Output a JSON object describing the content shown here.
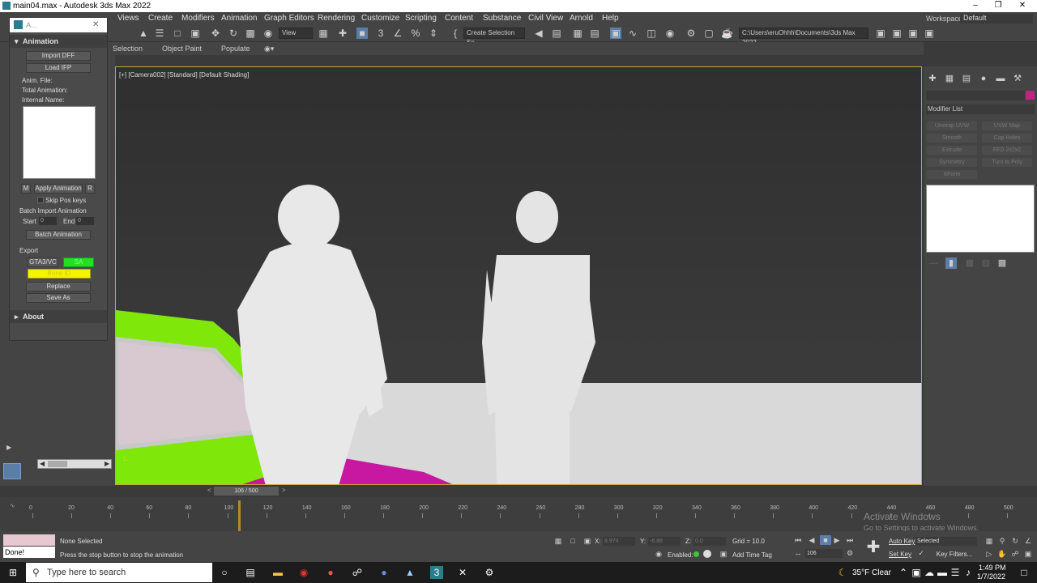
{
  "window": {
    "title": "main04.max - Autodesk 3ds Max 2022"
  },
  "menu": [
    "Views",
    "Create",
    "Modifiers",
    "Animation",
    "Graph Editors",
    "Rendering",
    "Customize",
    "Scripting",
    "Content",
    "Substance",
    "Civil View",
    "Arnold",
    "Help"
  ],
  "workspace": {
    "label": "Workspaces:",
    "value": "Default"
  },
  "toolbar": {
    "view_dropdown": "View",
    "selection_set_placeholder": "Create Selection Se",
    "project_path": "C:\\Users\\eruOhhh\\Documents\\3ds Max 2022"
  },
  "ribbon": [
    "Selection",
    "Object Paint",
    "Populate"
  ],
  "float_panel": {
    "title": "A...",
    "animation_rollout": "Animation",
    "import_dff": "Import DFF",
    "load_ifp": "Load IFP",
    "anim_file": "Anim. File:",
    "total_animation": "Total Animation:",
    "internal_name": "Internal Name:",
    "m_btn": "M",
    "apply_animation": "Apply Animation",
    "r_btn": "R",
    "skip_pos_keys": "Skip Pos keys",
    "batch_import": "Batch Import Animation",
    "start_label": "Start",
    "start_value": "0",
    "end_label": "End",
    "end_value": "0",
    "batch_animation": "Batch Animation",
    "export_label": "Export",
    "gta_btn": "GTA3/VC",
    "sa_btn": "SA",
    "bone_id": "Bone ID",
    "replace": "Replace",
    "save_as": "Save As",
    "about_rollout": "About"
  },
  "viewport": {
    "label": "[+] [Camera002] [Standard] [Default Shading]"
  },
  "command_panel": {
    "modifier_list": "Modifier List",
    "modifier_buttons": [
      "Unwrap UVW",
      "UVW Map",
      "Smooth",
      "Cap Holes",
      "Extrude",
      "FFD 2x2x2",
      "Symmetry",
      "Turn to Poly",
      "XForm"
    ],
    "object_color": "#c8207f"
  },
  "time_slider": {
    "label": "106 / 500",
    "current_frame": 106,
    "total_frames": 500
  },
  "trackbar": {
    "ticks": [
      "0",
      "20",
      "40",
      "60",
      "80",
      "100",
      "120",
      "140",
      "160",
      "180",
      "200",
      "220",
      "240",
      "260",
      "280",
      "300",
      "320",
      "340",
      "360",
      "380",
      "400",
      "420",
      "440",
      "460",
      "480",
      "500"
    ]
  },
  "activation": {
    "title": "Activate Windows",
    "subtitle": "Go to Settings to activate Windows."
  },
  "status": {
    "selection": "None Selected",
    "prompt": "Press the stop button to stop the animation",
    "done": "Done!",
    "x_label": "X:",
    "x_value": "8.974",
    "y_label": "Y:",
    "y_value": "-6.86",
    "z_label": "Z:",
    "z_value": "0.0",
    "grid": "Grid = 10.0",
    "enabled": "Enabled:",
    "add_time_tag": "Add Time Tag",
    "auto_key": "Auto Key",
    "selected": "Selected",
    "set_key": "Set Key",
    "key_filters": "Key Filters...",
    "frame_field": "106"
  },
  "taskbar": {
    "search_placeholder": "Type here to search",
    "weather": "35°F  Clear",
    "time": "1:49 PM",
    "date": "1/7/2022"
  }
}
